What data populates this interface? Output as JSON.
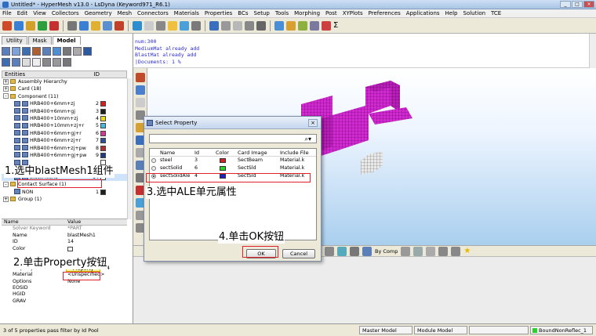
{
  "window": {
    "title": "Untitled* - HyperMesh v13.0 - LsDyna (Keyword971_R6.1)"
  },
  "menu": [
    "File",
    "Edit",
    "View",
    "Collectors",
    "Geometry",
    "Mesh",
    "Connectors",
    "Materials",
    "Properties",
    "BCs",
    "Setup",
    "Tools",
    "Morphing",
    "Post",
    "XYPlots",
    "Preferences",
    "Applications",
    "Help",
    "Solution",
    "TCE"
  ],
  "left_tabs": [
    "Utility",
    "Mask",
    "Model"
  ],
  "entities": {
    "header": "Entities",
    "id_header": "ID",
    "rows": [
      {
        "label": "Assembly Hierarchy",
        "indent": 0,
        "kind": "folder",
        "exp": "+"
      },
      {
        "label": "Card (18)",
        "indent": 0,
        "kind": "folder",
        "exp": "+"
      },
      {
        "label": "Component (11)",
        "indent": 0,
        "kind": "folder",
        "exp": "-"
      },
      {
        "label": "HRB400+6mm+zj",
        "indent": 1,
        "kind": "comp",
        "id": "2",
        "color": "#d42020"
      },
      {
        "label": "HRB400+6mm+gj",
        "indent": 1,
        "kind": "comp",
        "id": "3",
        "color": "#1f1f1f"
      },
      {
        "label": "HRB400+10mm+zj",
        "indent": 1,
        "kind": "comp",
        "id": "4",
        "color": "#e6d91e"
      },
      {
        "label": "HRB400+10mm+zj+r",
        "indent": 1,
        "kind": "comp",
        "id": "5",
        "color": "#47b8e0"
      },
      {
        "label": "HRB400+6mm+gj+r",
        "indent": 1,
        "kind": "comp",
        "id": "6",
        "color": "#d03a93"
      },
      {
        "label": "HRB400+6mm+zj+r",
        "indent": 1,
        "kind": "comp",
        "id": "7",
        "color": "#2f4f95"
      },
      {
        "label": "HRB400+6mm+zj+pw",
        "indent": 1,
        "kind": "comp",
        "id": "8",
        "color": "#b03030"
      },
      {
        "label": "HRB400+6mm+gj+pw",
        "indent": 1,
        "kind": "comp",
        "id": "9",
        "color": "#203a80"
      },
      {
        "label": "",
        "indent": 1,
        "kind": "comp",
        "id": "",
        "color": "#ffffff"
      },
      {
        "label": "",
        "indent": 1,
        "kind": "comp",
        "id": "",
        "color": "#ffffff"
      },
      {
        "label": "blastMesh1",
        "indent": 1,
        "kind": "comp",
        "id": "14",
        "color": "#ffffff",
        "selected": true
      },
      {
        "label": "Contact Surface (1)",
        "indent": 0,
        "kind": "folder",
        "exp": "-"
      },
      {
        "label": "NON",
        "indent": 1,
        "kind": "plain",
        "id": "1",
        "color": "#1f1f1f"
      },
      {
        "label": "Group (1)",
        "indent": 0,
        "kind": "folder",
        "exp": "+"
      }
    ]
  },
  "props": {
    "head_name": "Name",
    "head_value": "Value",
    "rows": [
      {
        "k": "Solver Keyword",
        "v": "*PART",
        "gray": true
      },
      {
        "k": "Name",
        "v": "blastMesh1"
      },
      {
        "k": "ID",
        "v": "14"
      },
      {
        "k": "Color",
        "v": ""
      },
      {
        "k": "",
        "v": ""
      },
      {
        "k": "Card Image",
        "v": ""
      },
      {
        "k": "Property",
        "v": "Property",
        "button": true,
        "extra": "14"
      },
      {
        "k": "Material",
        "v": "<Unspecified>"
      },
      {
        "k": "Options",
        "v": "None"
      },
      {
        "k": "EOSID",
        "v": ""
      },
      {
        "k": "HGID",
        "v": ""
      },
      {
        "k": "GRAV",
        "v": ""
      }
    ]
  },
  "command": {
    "lines": [
      "num:300",
      "MediumMat already add",
      "BlastMat already add",
      "|Documents: 1 %"
    ]
  },
  "dialog": {
    "title": "Select Property",
    "search_icon": "search-icon",
    "headers": {
      "name": "Name",
      "id": "Id",
      "color": "Color",
      "card": "Card Image",
      "include": "Include File"
    },
    "rows": [
      {
        "name": "steel",
        "id": "3",
        "color": "#d42020",
        "card": "SectBeam",
        "include": "Material.k"
      },
      {
        "name": "sectSolid",
        "id": "6",
        "color": "#2bd12b",
        "card": "SectSld",
        "include": "Material.k"
      },
      {
        "name": "sectSolidAle",
        "id": "4",
        "color": "#2020c8",
        "card": "SectSld",
        "include": "Material.k",
        "checked": true
      }
    ],
    "ok": "OK",
    "cancel": "Cancel"
  },
  "bottom_bar": {
    "by_comp": "By Comp"
  },
  "status": {
    "left": "3 of 5 properties pass filter by Id Pool",
    "model": "Master Model",
    "module": "Module Model",
    "extra": "BoundNonReflec_1"
  },
  "captions": {
    "step1": "1.选中blastMesh1组件",
    "step2": "2.单击Property按钮",
    "step3": "3.选中ALE单元属性",
    "step4": "4.单击OK按钮"
  },
  "colors": {
    "annotation_red": "#e0202a",
    "mesh_magenta": "#d12ad1"
  }
}
